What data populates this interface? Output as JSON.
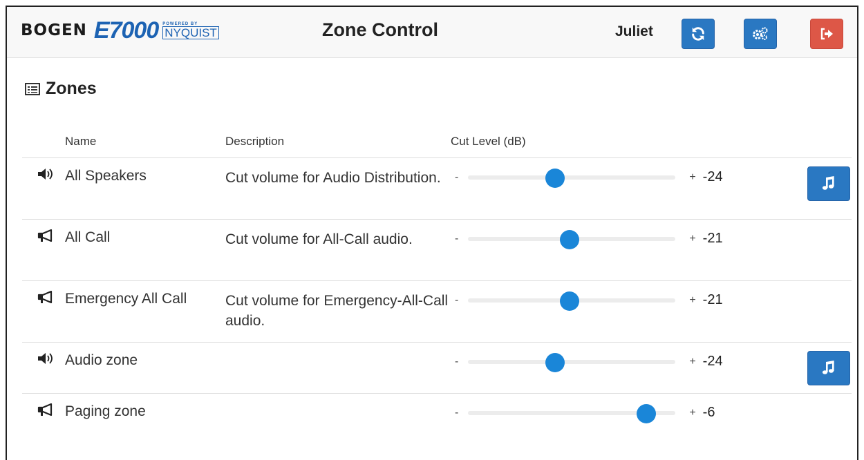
{
  "header": {
    "logo_bogen": "BOGEN",
    "logo_product": "E7000",
    "logo_poweredby": "POWERED BY",
    "logo_nyquist": "NYQUIST",
    "title": "Zone Control",
    "user": "Juliet",
    "buttons": [
      {
        "icon": "refresh-icon",
        "color": "#2a78c2"
      },
      {
        "icon": "gears-icon",
        "color": "#2a78c2"
      },
      {
        "icon": "sign-out-icon",
        "color": "#dd5747"
      }
    ]
  },
  "section": {
    "title": "Zones",
    "icon": "list-icon"
  },
  "table": {
    "headers": {
      "name": "Name",
      "description": "Description",
      "cut_level": "Cut Level (dB)"
    },
    "rows": [
      {
        "icon": "speaker-icon",
        "name": "All Speakers",
        "description": "Cut volume for Audio Distribution.",
        "level": -24,
        "level_text": "-24",
        "level_fraction": 0.42,
        "has_audio_button": true
      },
      {
        "icon": "megaphone-icon",
        "name": "All Call",
        "description": "Cut volume for All-Call audio.",
        "level": -21,
        "level_text": "-21",
        "level_fraction": 0.49,
        "has_audio_button": false
      },
      {
        "icon": "megaphone-icon",
        "name": "Emergency All Call",
        "description": "Cut volume for Emergency-All-Call audio.",
        "level": -21,
        "level_text": "-21",
        "level_fraction": 0.49,
        "has_audio_button": false
      },
      {
        "icon": "speaker-icon",
        "name": "Audio zone",
        "description": "",
        "level": -24,
        "level_text": "-24",
        "level_fraction": 0.42,
        "has_audio_button": true
      },
      {
        "icon": "megaphone-icon",
        "name": "Paging zone",
        "description": "",
        "level": -6,
        "level_text": "-6",
        "level_fraction": 0.86,
        "has_audio_button": false
      }
    ],
    "slider_minus": "-",
    "slider_plus": "+"
  }
}
